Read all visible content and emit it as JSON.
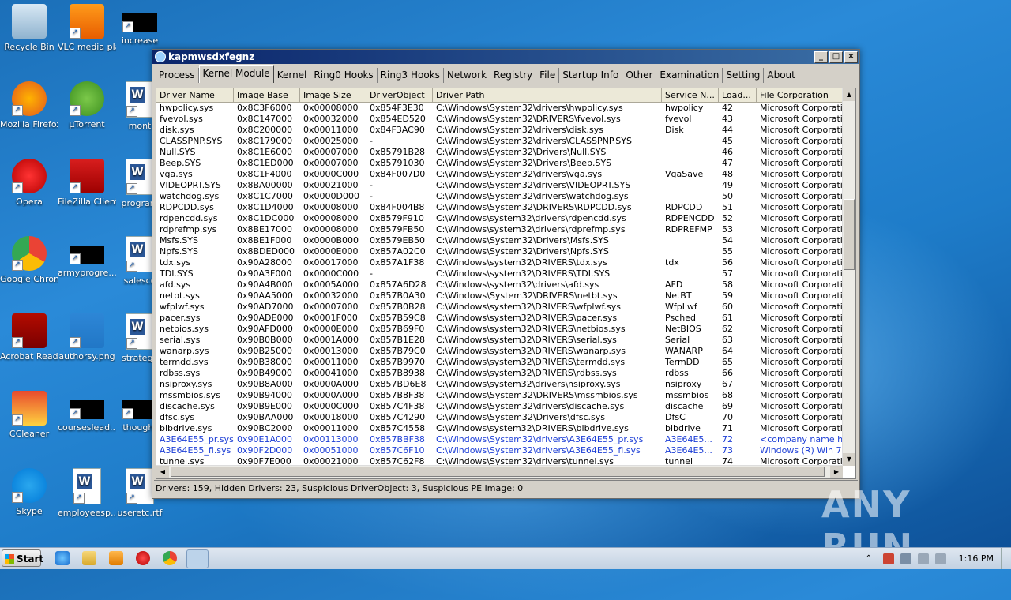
{
  "desktop": {
    "icons": [
      {
        "label": "Recycle Bin"
      },
      {
        "label": "VLC media player"
      },
      {
        "label": "increase"
      },
      {
        "label": "Mozilla Firefox"
      },
      {
        "label": "µTorrent"
      },
      {
        "label": "mont"
      },
      {
        "label": "Opera"
      },
      {
        "label": "FileZilla Client"
      },
      {
        "label": "program"
      },
      {
        "label": "Google Chrome"
      },
      {
        "label": "armyprogre..."
      },
      {
        "label": "salesco"
      },
      {
        "label": "Acrobat Reader DC"
      },
      {
        "label": "authorsy.png"
      },
      {
        "label": "strategy"
      },
      {
        "label": "CCleaner"
      },
      {
        "label": "courseslead..."
      },
      {
        "label": "thought"
      },
      {
        "label": "Skype"
      },
      {
        "label": "employeesp..."
      },
      {
        "label": "useretc.rtf"
      }
    ]
  },
  "window": {
    "title": "kapmwsdxfegnz",
    "buttons": {
      "minimize": "_",
      "maximize": "□",
      "close": "×"
    },
    "tabs": [
      "Process",
      "Kernel Module",
      "Kernel",
      "Ring0 Hooks",
      "Ring3 Hooks",
      "Network",
      "Registry",
      "File",
      "Startup Info",
      "Other",
      "Examination",
      "Setting",
      "About"
    ],
    "active_tab": "Kernel Module",
    "columns": [
      "Driver Name",
      "Image Base",
      "Image Size",
      "DriverObject",
      "Driver Path",
      "Service N...",
      "Load...",
      "File Corporation"
    ],
    "rows": [
      [
        "hwpolicy.sys",
        "0x8C3F6000",
        "0x00008000",
        "0x854F3E30",
        "C:\\Windows\\System32\\drivers\\hwpolicy.sys",
        "hwpolicy",
        "42",
        "Microsoft Corporation"
      ],
      [
        "fvevol.sys",
        "0x8C147000",
        "0x00032000",
        "0x854ED520",
        "C:\\Windows\\System32\\DRIVERS\\fvevol.sys",
        "fvevol",
        "43",
        "Microsoft Corporation"
      ],
      [
        "disk.sys",
        "0x8C200000",
        "0x00011000",
        "0x84F3AC90",
        "C:\\Windows\\System32\\drivers\\disk.sys",
        "Disk",
        "44",
        "Microsoft Corporation"
      ],
      [
        "CLASSPNP.SYS",
        "0x8C179000",
        "0x00025000",
        "-",
        "C:\\Windows\\System32\\drivers\\CLASSPNP.SYS",
        "",
        "45",
        "Microsoft Corporation"
      ],
      [
        "Null.SYS",
        "0x8C1E6000",
        "0x00007000",
        "0x85791B28",
        "C:\\Windows\\System32\\Drivers\\Null.SYS",
        "",
        "46",
        "Microsoft Corporation"
      ],
      [
        "Beep.SYS",
        "0x8C1ED000",
        "0x00007000",
        "0x85791030",
        "C:\\Windows\\System32\\Drivers\\Beep.SYS",
        "",
        "47",
        "Microsoft Corporation"
      ],
      [
        "vga.sys",
        "0x8C1F4000",
        "0x0000C000",
        "0x84F007D0",
        "C:\\Windows\\System32\\drivers\\vga.sys",
        "VgaSave",
        "48",
        "Microsoft Corporation"
      ],
      [
        "VIDEOPRT.SYS",
        "0x8BA00000",
        "0x00021000",
        "-",
        "C:\\Windows\\System32\\drivers\\VIDEOPRT.SYS",
        "",
        "49",
        "Microsoft Corporation"
      ],
      [
        "watchdog.sys",
        "0x8C1C7000",
        "0x0000D000",
        "-",
        "C:\\Windows\\System32\\drivers\\watchdog.sys",
        "",
        "50",
        "Microsoft Corporation"
      ],
      [
        "RDPCDD.sys",
        "0x8C1D4000",
        "0x00008000",
        "0x84F004B8",
        "C:\\Windows\\System32\\DRIVERS\\RDPCDD.sys",
        "RDPCDD",
        "51",
        "Microsoft Corporation"
      ],
      [
        "rdpencdd.sys",
        "0x8C1DC000",
        "0x00008000",
        "0x8579F910",
        "C:\\Windows\\system32\\drivers\\rdpencdd.sys",
        "RDPENCDD",
        "52",
        "Microsoft Corporation"
      ],
      [
        "rdprefmp.sys",
        "0x8BE17000",
        "0x00008000",
        "0x8579FB50",
        "C:\\Windows\\system32\\drivers\\rdprefmp.sys",
        "RDPREFMP",
        "53",
        "Microsoft Corporation"
      ],
      [
        "Msfs.SYS",
        "0x8BE1F000",
        "0x0000B000",
        "0x8579EB50",
        "C:\\Windows\\System32\\Drivers\\Msfs.SYS",
        "",
        "54",
        "Microsoft Corporation"
      ],
      [
        "Npfs.SYS",
        "0x8BDED000",
        "0x0000E000",
        "0x857A02C0",
        "C:\\Windows\\System32\\Drivers\\Npfs.SYS",
        "",
        "55",
        "Microsoft Corporation"
      ],
      [
        "tdx.sys",
        "0x90A28000",
        "0x00017000",
        "0x857A1F38",
        "C:\\Windows\\system32\\DRIVERS\\tdx.sys",
        "tdx",
        "56",
        "Microsoft Corporation"
      ],
      [
        "TDI.SYS",
        "0x90A3F000",
        "0x0000C000",
        "-",
        "C:\\Windows\\system32\\DRIVERS\\TDI.SYS",
        "",
        "57",
        "Microsoft Corporation"
      ],
      [
        "afd.sys",
        "0x90A4B000",
        "0x0005A000",
        "0x857A6D28",
        "C:\\Windows\\system32\\drivers\\afd.sys",
        "AFD",
        "58",
        "Microsoft Corporation"
      ],
      [
        "netbt.sys",
        "0x90AA5000",
        "0x00032000",
        "0x857B0A30",
        "C:\\Windows\\System32\\DRIVERS\\netbt.sys",
        "NetBT",
        "59",
        "Microsoft Corporation"
      ],
      [
        "wfplwf.sys",
        "0x90AD7000",
        "0x00007000",
        "0x857B0B28",
        "C:\\Windows\\system32\\DRIVERS\\wfplwf.sys",
        "WfpLwf",
        "60",
        "Microsoft Corporation"
      ],
      [
        "pacer.sys",
        "0x90ADE000",
        "0x0001F000",
        "0x857B59C8",
        "C:\\Windows\\system32\\DRIVERS\\pacer.sys",
        "Psched",
        "61",
        "Microsoft Corporation"
      ],
      [
        "netbios.sys",
        "0x90AFD000",
        "0x0000E000",
        "0x857B69F0",
        "C:\\Windows\\system32\\DRIVERS\\netbios.sys",
        "NetBIOS",
        "62",
        "Microsoft Corporation"
      ],
      [
        "serial.sys",
        "0x90B0B000",
        "0x0001A000",
        "0x857B1E28",
        "C:\\Windows\\system32\\DRIVERS\\serial.sys",
        "Serial",
        "63",
        "Microsoft Corporation"
      ],
      [
        "wanarp.sys",
        "0x90B25000",
        "0x00013000",
        "0x857B79C0",
        "C:\\Windows\\system32\\DRIVERS\\wanarp.sys",
        "WANARP",
        "64",
        "Microsoft Corporation"
      ],
      [
        "termdd.sys",
        "0x90B38000",
        "0x00011000",
        "0x857B9970",
        "C:\\Windows\\system32\\DRIVERS\\termdd.sys",
        "TermDD",
        "65",
        "Microsoft Corporation"
      ],
      [
        "rdbss.sys",
        "0x90B49000",
        "0x00041000",
        "0x857B8938",
        "C:\\Windows\\system32\\DRIVERS\\rdbss.sys",
        "rdbss",
        "66",
        "Microsoft Corporation"
      ],
      [
        "nsiproxy.sys",
        "0x90B8A000",
        "0x0000A000",
        "0x857BD6E8",
        "C:\\Windows\\system32\\drivers\\nsiproxy.sys",
        "nsiproxy",
        "67",
        "Microsoft Corporation"
      ],
      [
        "mssmbios.sys",
        "0x90B94000",
        "0x0000A000",
        "0x857B8F38",
        "C:\\Windows\\System32\\DRIVERS\\mssmbios.sys",
        "mssmbios",
        "68",
        "Microsoft Corporation"
      ],
      [
        "discache.sys",
        "0x90B9E000",
        "0x0000C000",
        "0x857C4F38",
        "C:\\Windows\\System32\\drivers\\discache.sys",
        "discache",
        "69",
        "Microsoft Corporation"
      ],
      [
        "dfsc.sys",
        "0x90BAA000",
        "0x00018000",
        "0x857C4290",
        "C:\\Windows\\System32\\Drivers\\dfsc.sys",
        "DfsC",
        "70",
        "Microsoft Corporation"
      ],
      [
        "blbdrive.sys",
        "0x90BC2000",
        "0x00011000",
        "0x857C4558",
        "C:\\Windows\\system32\\DRIVERS\\blbdrive.sys",
        "blbdrive",
        "71",
        "Microsoft Corporation"
      ],
      [
        "A3E64E55_pr.sys",
        "0x90E1A000",
        "0x00113000",
        "0x857BBF38",
        "C:\\Windows\\System32\\drivers\\A3E64E55_pr.sys",
        "A3E64E5...",
        "72",
        "<company name he..."
      ],
      [
        "A3E64E55_fl.sys",
        "0x90F2D000",
        "0x00051000",
        "0x857C6F10",
        "C:\\Windows\\System32\\drivers\\A3E64E55_fl.sys",
        "A3E64E5...",
        "73",
        "Windows (R) Win 7 ..."
      ],
      [
        "tunnel.sys",
        "0x90F7E000",
        "0x00021000",
        "0x857C62F8",
        "C:\\Windows\\System32\\drivers\\tunnel.sys",
        "tunnel",
        "74",
        "Microsoft Corporation"
      ]
    ],
    "highlighted_rows": [
      30,
      31
    ],
    "status": "Drivers: 159, Hidden Drivers: 23, Suspicious DriverObject: 3, Suspicious PE Image: 0"
  },
  "watermark": "ANY RUN",
  "taskbar": {
    "start_label": "Start",
    "clock": "1:16 PM",
    "pinned": [
      "internet-explorer-icon",
      "explorer-icon",
      "media-player-icon",
      "opera-icon",
      "chrome-icon",
      "app-icon"
    ]
  }
}
